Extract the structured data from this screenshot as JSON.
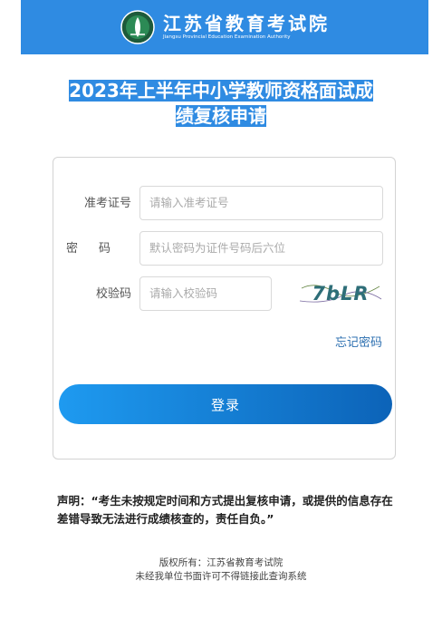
{
  "header": {
    "name_cn": "江苏省教育考试院",
    "name_en": "Jiangsu Provincial Education Examination Authority"
  },
  "title": {
    "line1": "2023年上半年中小学教师资格面试成",
    "line2": "绩复核申请"
  },
  "form": {
    "ticket_label": "准考证号",
    "ticket_placeholder": "请输入准考证号",
    "password_label": "密码",
    "password_placeholder": "默认密码为证件号码后六位",
    "captcha_label": "校验码",
    "captcha_placeholder": "请输入校验码",
    "captcha_text": "7bLR",
    "forgot_label": "忘记密码",
    "login_label": "登录"
  },
  "notice": {
    "text": "声明：“考生未按规定时间和方式提出复核申请，或提供的信息存在差错导致无法进行成绩核查的，责任自负。”"
  },
  "footer": {
    "copyright": "版权所有：江苏省教育考试院",
    "disclaimer": "未经我单位书面许可不得链接此查询系统"
  },
  "colors": {
    "header_bg": "#2f8be2",
    "title_highlight": "#2f8be2",
    "button_start": "#1e9af0",
    "button_end": "#0c63b8",
    "link": "#2c6fb0"
  },
  "icons": {
    "logo": "jseea-emblem-icon"
  }
}
